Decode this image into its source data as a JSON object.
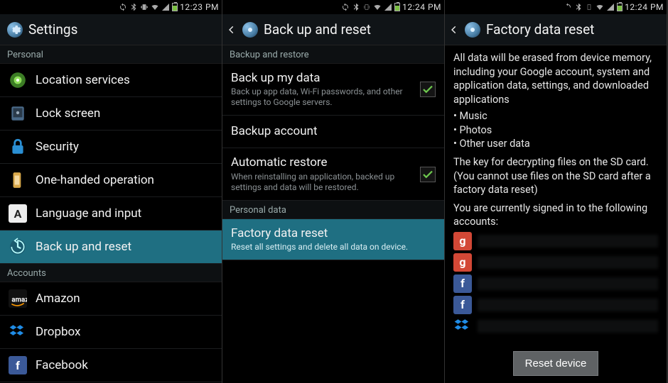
{
  "statusbar": {
    "time1": "12:23 PM",
    "time2": "12:24 PM",
    "time3": "12:24 PM"
  },
  "screen1": {
    "title": "Settings",
    "section_personal": "Personal",
    "items": {
      "location": "Location services",
      "lockscreen": "Lock screen",
      "security": "Security",
      "onehanded": "One-handed operation",
      "language": "Language and input",
      "backup": "Back up and reset"
    },
    "section_accounts": "Accounts",
    "accounts": {
      "amazon": "Amazon",
      "dropbox": "Dropbox",
      "facebook": "Facebook"
    }
  },
  "screen2": {
    "title": "Back up and reset",
    "section_backup": "Backup and restore",
    "rows": {
      "backup_data": {
        "label": "Back up my data",
        "sub": "Back up app data, Wi-Fi passwords, and other settings to Google servers.",
        "checked": true
      },
      "backup_account": {
        "label": "Backup account",
        "sub": ""
      },
      "auto_restore": {
        "label": "Automatic restore",
        "sub": "When reinstalling an application, backed up settings and data will be restored.",
        "checked": true
      }
    },
    "section_personal_data": "Personal data",
    "factory": {
      "label": "Factory data reset",
      "sub": "Reset all settings and delete all data on device."
    }
  },
  "screen3": {
    "title": "Factory data reset",
    "para1": "All data will be erased from device memory, including your Google account, system and application data, settings, and downloaded applications",
    "bullets": [
      "Music",
      "Photos",
      "Other user data"
    ],
    "para2": "The key for decrypting files on the SD card. (You cannot use files on the SD card after a factory data reset)",
    "para3": "You are currently signed in to the following accounts:",
    "accounts": [
      {
        "type": "google"
      },
      {
        "type": "google"
      },
      {
        "type": "facebook"
      },
      {
        "type": "facebook"
      },
      {
        "type": "dropbox"
      }
    ],
    "button": "Reset device"
  }
}
